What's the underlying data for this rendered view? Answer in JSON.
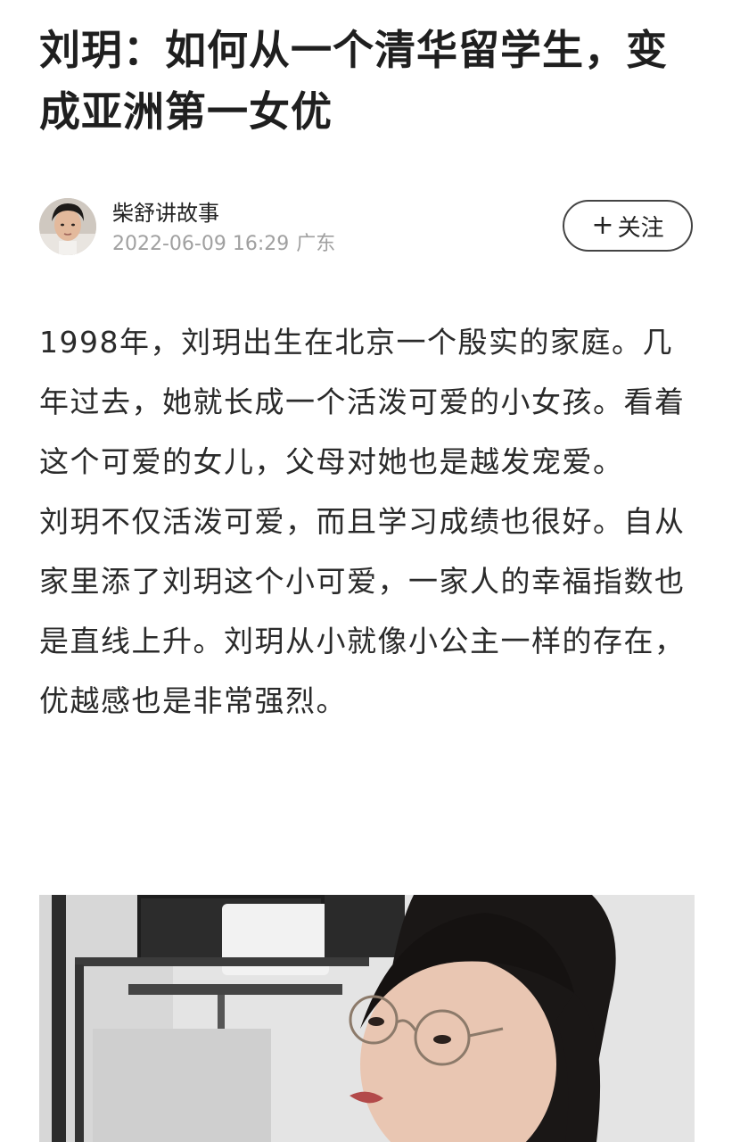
{
  "article": {
    "title": "刘玥：如何从一个清华留学生，变成亚洲第一女优",
    "author": {
      "name": "柴舒讲故事",
      "datetime": "2022-06-09 16:29",
      "location": "广东",
      "avatar_icon": "avatar-photo"
    },
    "follow_label": "关注",
    "follow_icon": "plus-icon",
    "paragraphs": [
      "1998年，刘玥出生在北京一个殷实的家庭。几年过去，她就长成一个活泼可爱的小女孩。看着这个可爱的女儿，父母对她也是越发宠爱。",
      "刘玥不仅活泼可爱，而且学习成绩也很好。自从家里添了刘玥这个小可爱，一家人的幸福指数也是直线上升。刘玥从小就像小公主一样的存在，优越感也是非常强烈。"
    ]
  }
}
